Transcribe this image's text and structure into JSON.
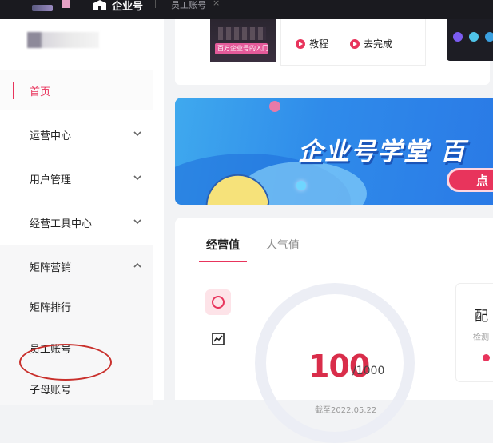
{
  "topbar": {
    "brand": "企业号",
    "breadcrumb": "员工账号",
    "close": "×"
  },
  "sidebar": {
    "items": [
      {
        "label": "首页"
      },
      {
        "label": "运营中心"
      },
      {
        "label": "用户管理"
      },
      {
        "label": "经营工具中心"
      },
      {
        "label": "矩阵营销"
      },
      {
        "label": "矩阵排行"
      },
      {
        "label": "员工账号"
      },
      {
        "label": "子母账号"
      }
    ]
  },
  "top_card": {
    "thumb_text": "百万企业号的入门",
    "tutorial": "教程",
    "complete": "去完成"
  },
  "banner": {
    "title": "企业号学堂 百",
    "cta": "点"
  },
  "stats": {
    "tabs": [
      "经营值",
      "人气值"
    ],
    "score": "100",
    "score_max": "/1000",
    "date": "截至2022.05.22",
    "right_card_title": "配",
    "right_card_sub": "检测"
  },
  "colors": {
    "accent": "#e8345c",
    "banner": "#2f8bea",
    "topbar": "#1a1a1f"
  }
}
